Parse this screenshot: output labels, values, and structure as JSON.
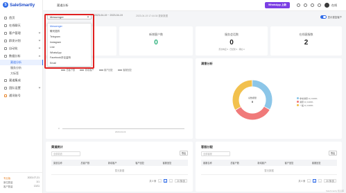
{
  "brand": {
    "name": "SaleSmartly",
    "logo_letter": "S"
  },
  "sidebar": {
    "items": [
      {
        "label": "首页",
        "has_children": false
      },
      {
        "label": "在线聊天",
        "has_children": false
      },
      {
        "label": "客户管理",
        "has_children": true
      },
      {
        "label": "群发计划",
        "has_children": true
      },
      {
        "label": "自动化",
        "has_children": true
      },
      {
        "label": "数据分析",
        "has_children": true
      }
    ],
    "sub_items": [
      {
        "label": "渠道分析",
        "active": true
      },
      {
        "label": "服务分析",
        "active": false
      },
      {
        "label": "大标签",
        "active": false
      }
    ],
    "items_after": [
      {
        "label": "渠道集成",
        "has_children": false
      },
      {
        "label": "团队设置",
        "has_children": true
      },
      {
        "label": "通讯账号",
        "has_children": false
      }
    ],
    "footer": [
      {
        "label": "专业版",
        "value": "2023-07-21"
      },
      {
        "label": "席位数量",
        "value": "1/1"
      },
      {
        "label": "客户数量",
        "value": "13/11"
      }
    ]
  },
  "topbar": {
    "breadcrumb": "渠道分析",
    "promo_label": "WhatsApp 上新",
    "user_name": "在线"
  },
  "filters": {
    "channel_value": "Messenger",
    "date_range": "2023-04-19 ~ 2023-04-19",
    "updated_text": "2023-04-19 17:44:34 更新数据",
    "toggle_label": "显示重复客户",
    "toggle_on": true
  },
  "channel_options": [
    {
      "label": "Messenger",
      "selected": true
    },
    {
      "label": "聊天插件",
      "selected": false
    },
    {
      "label": "Telegram",
      "selected": false
    },
    {
      "label": "Instagram",
      "selected": false
    },
    {
      "label": "Line",
      "selected": false
    },
    {
      "label": "WhatsApp",
      "selected": false
    },
    {
      "label": "Facebook评论监听",
      "selected": false
    },
    {
      "label": "Email",
      "selected": false
    }
  ],
  "stats": [
    {
      "label": "新增客户数",
      "value": "0",
      "color": "green",
      "sub": ""
    },
    {
      "label": "服务会话数",
      "value": "0",
      "color": "default",
      "sub": "首次响应 0 · 已结束 0 · 转接 0"
    },
    {
      "label": "在线客服数",
      "value": "2",
      "color": "default",
      "sub": ""
    }
  ],
  "line_panel": {
    "legend": [
      "总客户数",
      "新增客户",
      "客户回复",
      "客服回复"
    ],
    "x_label": "2023-04-19",
    "y_label": "0"
  },
  "pie_panel": {
    "title": "满意分析",
    "center_label": "总数据量",
    "center_value": "0",
    "colors": [
      "#8cc6e8",
      "#f07a7a",
      "#f2c14e"
    ],
    "legend": [
      {
        "label": "非常满意 0 | 0.00%",
        "color": "#8cc6e8"
      },
      {
        "label": "满意 0 | 0.00%",
        "color": "#f07a7a"
      },
      {
        "label": "一般 0 | 0.00%",
        "color": "#f2c14e"
      }
    ]
  },
  "table_left": {
    "title": "渠道统计",
    "filter_placeholder": "全部渠道",
    "export_label": "导出",
    "columns": [
      "渠道名称",
      "总客户数",
      "新增客户",
      "客户回复",
      "客服回复"
    ],
    "empty_text": "暂无数据",
    "total_text": "共 0 条",
    "page": "1",
    "page_size": "20 条/页"
  },
  "table_right": {
    "title": "客服分配",
    "filter_placeholder": "全部客服",
    "export_label": "导出",
    "columns": [
      "客服名称",
      "总客户数",
      "新增客户",
      "客户回复",
      "客服回复"
    ],
    "empty_text": "暂无数据",
    "total_text": "共 0 条",
    "page": "1",
    "page_size": "20 条/页"
  },
  "watermark": "SaleSmartly 知识库"
}
